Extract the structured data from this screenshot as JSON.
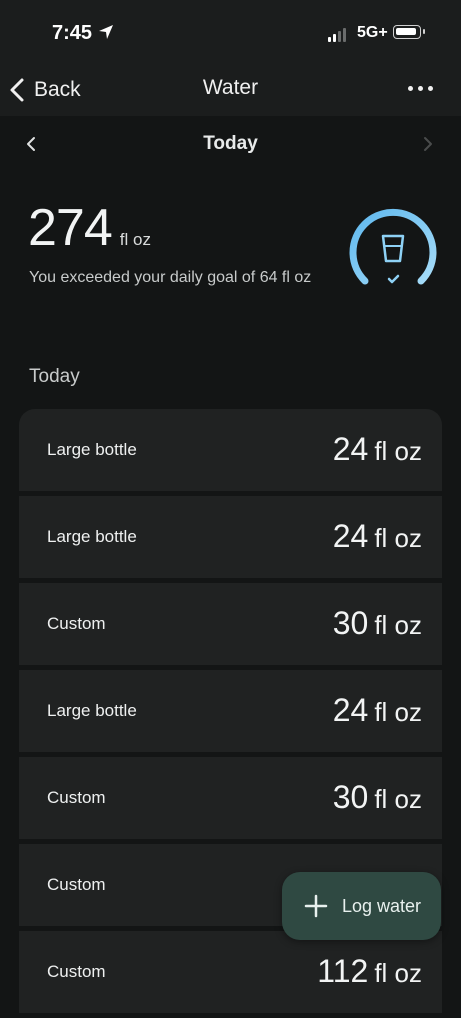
{
  "status_bar": {
    "time": "7:45",
    "network": "5G+",
    "icons": [
      "location-arrow-icon",
      "signal-icon",
      "battery-icon"
    ]
  },
  "nav": {
    "back_label": "Back",
    "title": "Water",
    "more_icon": "more-horizontal-icon"
  },
  "date_nav": {
    "label": "Today",
    "prev_icon": "chevron-left-icon",
    "next_icon": "chevron-right-icon"
  },
  "summary": {
    "total": "274",
    "unit": "fl oz",
    "goal_message": "You exceeded your daily goal of 64 fl oz",
    "goal_progress": 1.0,
    "ring_icon": "water-glass-check-icon",
    "ring_color": "#8ed1f5"
  },
  "section_label": "Today",
  "entries": [
    {
      "name": "Large bottle",
      "amount": "24",
      "unit": "fl oz"
    },
    {
      "name": "Large bottle",
      "amount": "24",
      "unit": "fl oz"
    },
    {
      "name": "Custom",
      "amount": "30",
      "unit": "fl oz"
    },
    {
      "name": "Large bottle",
      "amount": "24",
      "unit": "fl oz"
    },
    {
      "name": "Custom",
      "amount": "30",
      "unit": "fl oz"
    },
    {
      "name": "Custom",
      "amount": "",
      "unit": ""
    },
    {
      "name": "Custom",
      "amount": "112",
      "unit": "fl oz"
    }
  ],
  "fab": {
    "label": "Log water",
    "icon": "plus-icon",
    "color": "#2f4942"
  }
}
